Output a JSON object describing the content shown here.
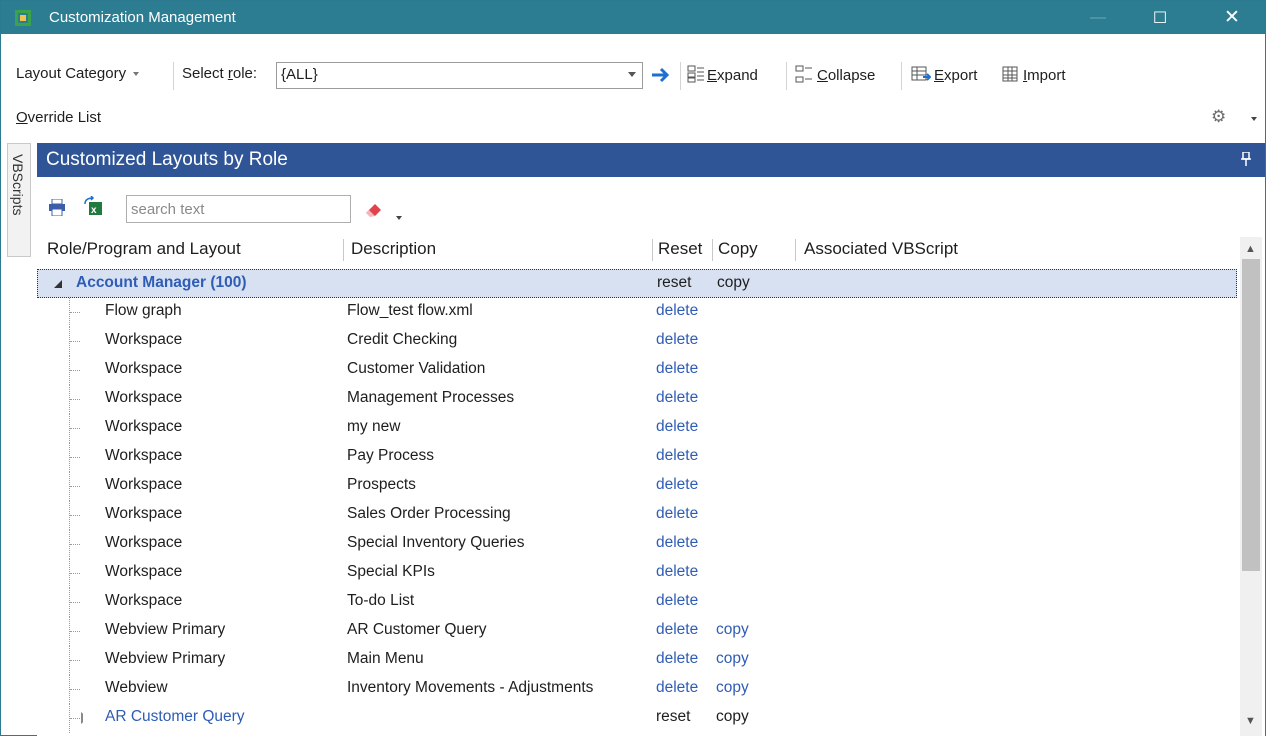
{
  "window": {
    "title": "Customization Management",
    "controls": {
      "minimize": "—",
      "maximize": "☐",
      "close": "✕"
    }
  },
  "toolbar": {
    "layout_category": "Layout Category",
    "select_role_label_pre": "Select ",
    "select_role_label_u": "r",
    "select_role_label_post": "ole:",
    "role_value": "{ALL}",
    "expand_u": "E",
    "expand_rest": "xpand",
    "collapse_u": "C",
    "collapse_rest": "ollapse",
    "export_u": "E",
    "export_rest": "xport",
    "import_u": "I",
    "import_rest": "mport"
  },
  "override_list": {
    "u": "O",
    "rest": "verride List"
  },
  "side_tab": {
    "label": "VBScripts"
  },
  "panel": {
    "title": "Customized Layouts by Role",
    "search_placeholder": "search text"
  },
  "grid": {
    "columns": {
      "role": "Role/Program and Layout",
      "description": "Description",
      "reset": "Reset",
      "copy": "Copy",
      "vbscript": "Associated VBScript"
    },
    "group": {
      "name": "Account Manager (100)",
      "reset": "reset",
      "copy": "copy"
    },
    "rows": [
      {
        "name": "Flow graph",
        "desc": "Flow_test flow.xml",
        "reset": "delete",
        "copy": ""
      },
      {
        "name": "Workspace",
        "desc": "Credit Checking",
        "reset": "delete",
        "copy": ""
      },
      {
        "name": "Workspace",
        "desc": "Customer Validation",
        "reset": "delete",
        "copy": ""
      },
      {
        "name": "Workspace",
        "desc": "Management Processes",
        "reset": "delete",
        "copy": ""
      },
      {
        "name": "Workspace",
        "desc": "my new",
        "reset": "delete",
        "copy": ""
      },
      {
        "name": "Workspace",
        "desc": "Pay Process",
        "reset": "delete",
        "copy": ""
      },
      {
        "name": "Workspace",
        "desc": "Prospects",
        "reset": "delete",
        "copy": ""
      },
      {
        "name": "Workspace",
        "desc": "Sales Order Processing",
        "reset": "delete",
        "copy": ""
      },
      {
        "name": "Workspace",
        "desc": "Special Inventory Queries",
        "reset": "delete",
        "copy": ""
      },
      {
        "name": "Workspace",
        "desc": "Special KPIs",
        "reset": "delete",
        "copy": ""
      },
      {
        "name": "Workspace",
        "desc": "To-do List",
        "reset": "delete",
        "copy": ""
      },
      {
        "name": "Webview Primary",
        "desc": "AR Customer Query",
        "reset": "delete",
        "copy": "copy"
      },
      {
        "name": "Webview Primary",
        "desc": "Main Menu",
        "reset": "delete",
        "copy": "copy"
      },
      {
        "name": "Webview",
        "desc": "Inventory Movements - Adjustments",
        "reset": "delete",
        "copy": "copy"
      }
    ],
    "subgroup": {
      "name": "AR Customer Query",
      "reset": "reset",
      "copy": "copy"
    }
  },
  "colors": {
    "titlebar": "#2d7d92",
    "panel_header": "#2f5597",
    "link": "#2f5cb5",
    "selected_row": "#d8e1f2"
  },
  "icons": [
    "app-icon",
    "go-arrow-icon",
    "expand-icon",
    "collapse-icon",
    "export-icon",
    "import-icon",
    "gear-icon",
    "pin-icon",
    "print-icon",
    "excel-icon",
    "eraser-icon"
  ]
}
